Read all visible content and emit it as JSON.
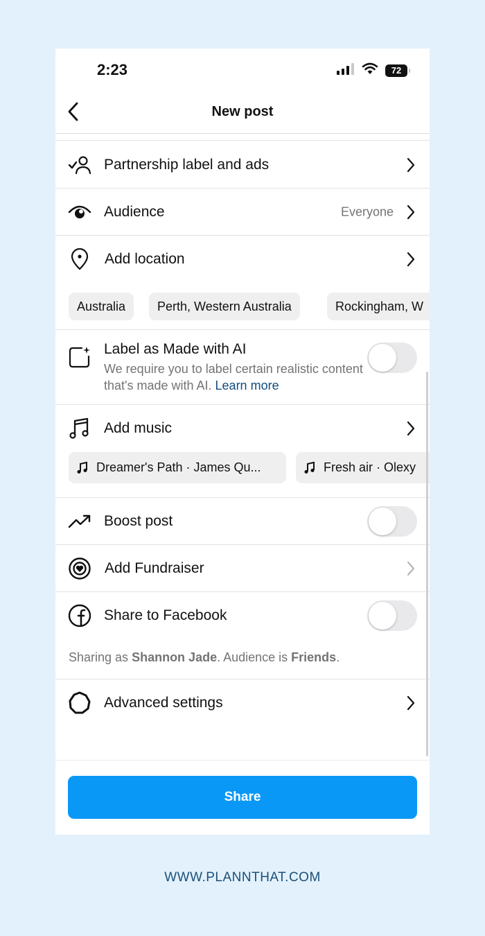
{
  "status": {
    "time": "2:23",
    "battery": "72"
  },
  "header": {
    "title": "New post"
  },
  "rows": {
    "partnership": "Partnership label and ads",
    "audience": "Audience",
    "audience_value": "Everyone",
    "location": "Add location",
    "location_chips": [
      "Australia",
      "Perth, Western Australia",
      "Rockingham, W"
    ],
    "ai_title": "Label as Made with AI",
    "ai_desc": "We require you to label certain realistic content that's made with AI.",
    "ai_link": "Learn more",
    "music": "Add music",
    "music_chips": [
      "Dreamer's Path · James Qu...",
      "Fresh air · Olexy"
    ],
    "boost": "Boost post",
    "fundraiser": "Add Fundraiser",
    "facebook": "Share to Facebook",
    "fb_note_prefix": "Sharing as ",
    "fb_note_name": "Shannon Jade",
    "fb_note_mid": ". Audience is ",
    "fb_note_audience": "Friends",
    "fb_note_end": ".",
    "advanced": "Advanced settings"
  },
  "toggles": {
    "ai_label": false,
    "boost": false,
    "facebook": false
  },
  "share_button": "Share",
  "footer": {
    "url": "WWW.PLANNTHAT.COM"
  },
  "colors": {
    "background": "#e3f1fc",
    "accent": "#0a98f7",
    "link": "#0f4c81",
    "footer": "#1b4f78"
  }
}
